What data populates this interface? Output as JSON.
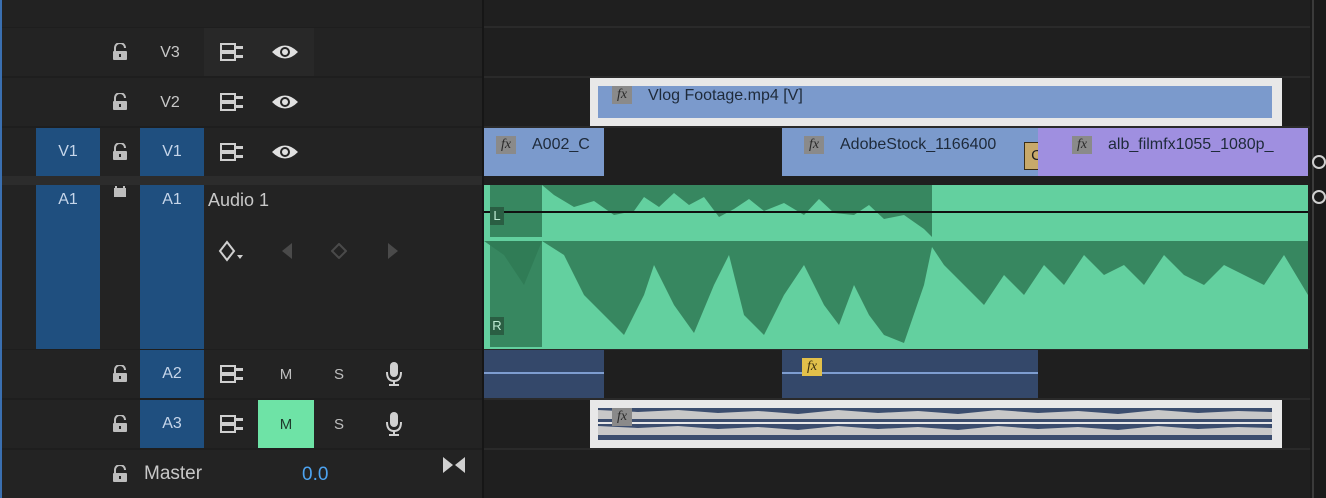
{
  "colors": {
    "target": "#1f4f7f",
    "video_clip": "#7b9acc",
    "video_clip_purple": "#9f8fe0",
    "audio_clip": "#63d09f",
    "audio_clip_dark": "#2f7a55",
    "mute_active": "#6ee3a6",
    "value_blue": "#4da3f0"
  },
  "tracks": {
    "v3": {
      "target_label": "V3",
      "lock_icon": "lock-open-icon",
      "sync_icon": "sync-lock-icon",
      "eye_icon": "eye-icon"
    },
    "v2": {
      "target_label": "V2"
    },
    "v1": {
      "source_label": "V1",
      "target_label": "V1"
    },
    "a1": {
      "source_label": "A1",
      "target_label": "A1",
      "name": "Audio 1"
    },
    "a2": {
      "target_label": "A2",
      "mute": "M",
      "solo": "S"
    },
    "a3": {
      "target_label": "A3",
      "mute": "M",
      "solo": "S",
      "mute_active": true
    },
    "master": {
      "label": "Master",
      "value": "0.0"
    }
  },
  "clips": {
    "v2_clip": {
      "name": "Vlog Footage.mp4 [V]",
      "fx": "fx"
    },
    "v1_clip1": {
      "name": "A002_C",
      "fx": "fx"
    },
    "v1_clip2": {
      "name": "AdobeStock_1166400",
      "fx": "fx",
      "transition": "Cr"
    },
    "v1_clip3": {
      "name": "alb_filmfx1055_1080p_",
      "fx": "fx"
    },
    "a1_channels": {
      "left": "L",
      "right": "R"
    },
    "a2_fx": "fx",
    "a3_fx": "fx"
  }
}
